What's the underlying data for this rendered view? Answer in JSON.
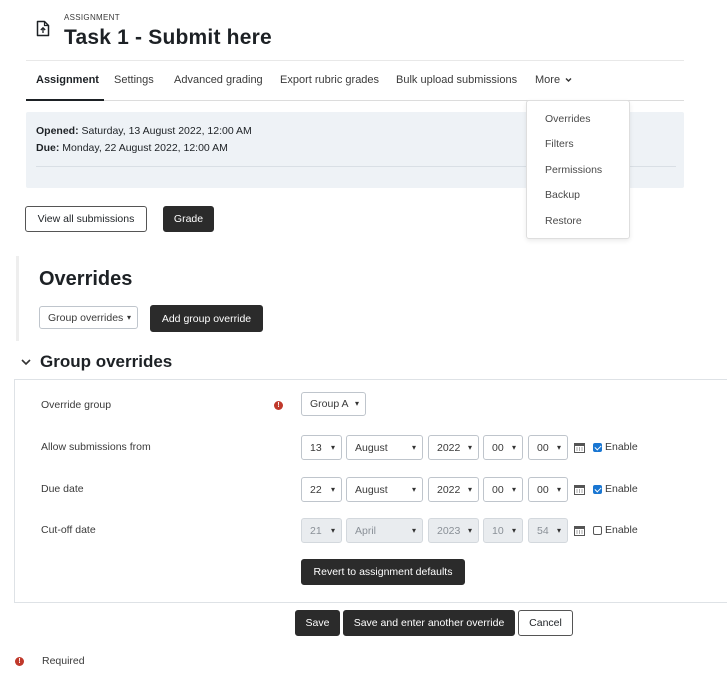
{
  "header": {
    "kicker": "ASSIGNMENT",
    "title": "Task 1 - Submit here",
    "icon": "assignment-doc-icon"
  },
  "tabs": [
    {
      "label": "Assignment",
      "active": true
    },
    {
      "label": "Settings"
    },
    {
      "label": "Advanced grading"
    },
    {
      "label": "Export rubric grades"
    },
    {
      "label": "Bulk upload submissions"
    },
    {
      "label": "More"
    }
  ],
  "more_menu": {
    "items": [
      "Overrides",
      "Filters",
      "Permissions",
      "Backup",
      "Restore"
    ]
  },
  "dates": {
    "opened_label": "Opened:",
    "opened_value": "Saturday, 13 August 2022, 12:00 AM",
    "due_label": "Due:",
    "due_value": "Monday, 22 August 2022, 12:00 AM"
  },
  "actions": {
    "view_all": "View all submissions",
    "grade": "Grade"
  },
  "overrides": {
    "heading": "Overrides",
    "type_select": "Group overrides",
    "add_button": "Add group override"
  },
  "group_overrides": {
    "heading": "Group overrides",
    "override_group_label": "Override group",
    "override_group_value": "Group A",
    "rows": [
      {
        "label": "Allow submissions from",
        "day": "13",
        "month": "August",
        "year": "2022",
        "hour": "00",
        "minute": "00",
        "enable": "Enable",
        "enabled": true
      },
      {
        "label": "Due date",
        "day": "22",
        "month": "August",
        "year": "2022",
        "hour": "00",
        "minute": "00",
        "enable": "Enable",
        "enabled": true
      },
      {
        "label": "Cut-off date",
        "day": "21",
        "month": "April",
        "year": "2023",
        "hour": "10",
        "minute": "54",
        "enable": "Enable",
        "enabled": false
      }
    ],
    "revert_button": "Revert to assignment defaults"
  },
  "footer_buttons": {
    "save": "Save",
    "save_another": "Save and enter another override",
    "cancel": "Cancel"
  },
  "required_legend": "Required",
  "colors": {
    "accent_dark": "#2b2b2b",
    "required": "#c0392b",
    "checkbox": "#1976d2",
    "info_bg": "#eef2f6"
  }
}
